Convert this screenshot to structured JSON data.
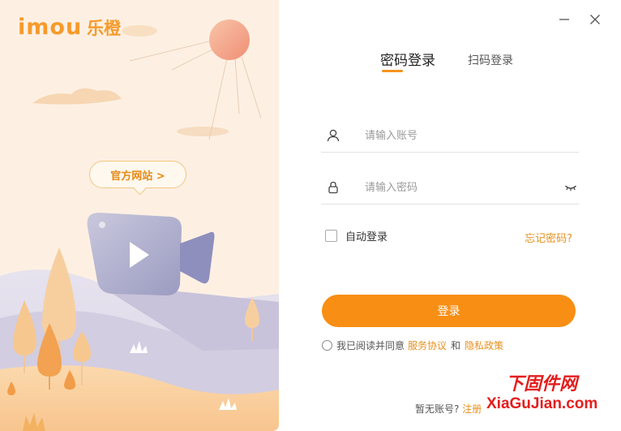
{
  "brand": {
    "latin": "imou",
    "chinese": "乐橙"
  },
  "left": {
    "official_site_label": "官方网站 >"
  },
  "window": {
    "minimize_icon": "minimize-icon",
    "close_icon": "close-icon"
  },
  "tabs": [
    {
      "label": "密码登录",
      "active": true
    },
    {
      "label": "扫码登录",
      "active": false
    }
  ],
  "form": {
    "account_placeholder": "请输入账号",
    "password_placeholder": "请输入密码",
    "account_icon": "user-icon",
    "password_icon": "lock-icon",
    "eye_icon": "eye-closed-icon",
    "auto_login_label": "自动登录",
    "auto_login_checked": false,
    "forgot_password_label": "忘记密码?",
    "login_button_label": "登录"
  },
  "agreement": {
    "prefix": "我已阅读并同意",
    "terms_label": "服务协议",
    "and": "和",
    "privacy_label": "隐私政策"
  },
  "signup": {
    "prompt": "暂无账号?",
    "link_label": "注册"
  },
  "watermark": {
    "chinese": "下固件网",
    "latin": "XiaGuJian.com"
  },
  "colors": {
    "accent": "#f88e14",
    "link": "#e8901d",
    "left_bg": "#fdf0e3"
  }
}
